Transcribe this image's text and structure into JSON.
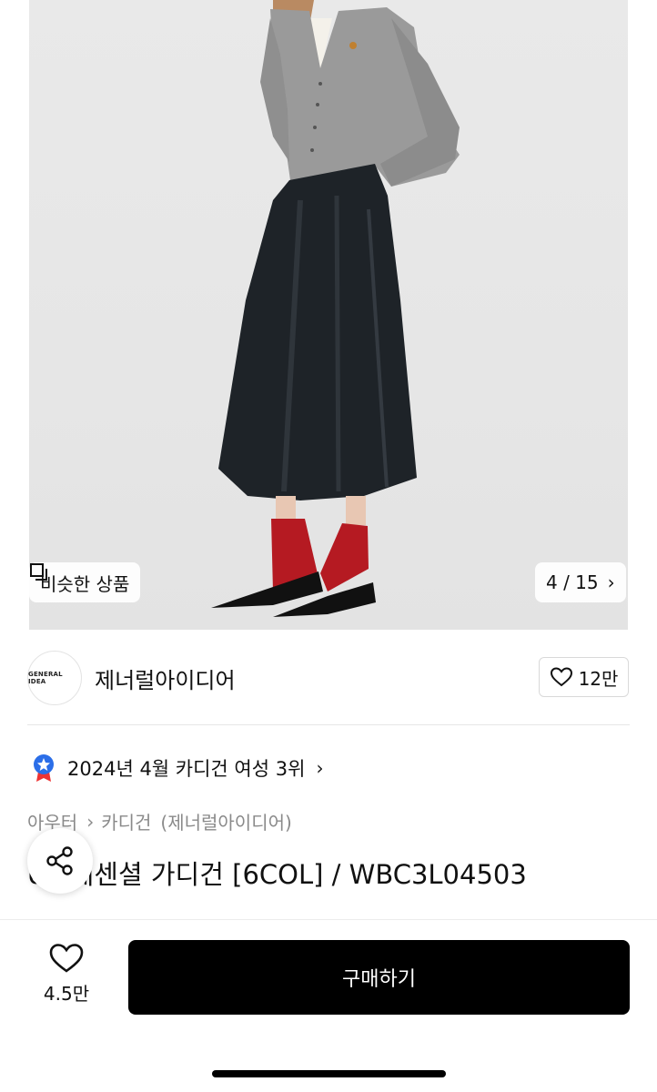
{
  "hero": {
    "similar_label": "비슷한 상품",
    "page_indicator": "4 / 15",
    "icons": [
      "similar-products-icon",
      "chevron-right-icon"
    ]
  },
  "brand": {
    "logo_text": "GENERAL IDEA",
    "name": "제너럴아이디어",
    "likes": "12만"
  },
  "ranking": {
    "text": "2024년 4월 카디건 여성 3위",
    "icon": "star-badge-icon"
  },
  "breadcrumb": {
    "category": "아우터",
    "subcategory": "카디건",
    "brand": "(제너럴아이디어)"
  },
  "product": {
    "title_visible": "L 에센셜 가디건 [6COL] / WBC3L04503",
    "title_fragment": "U"
  },
  "bottom_bar": {
    "wish_count": "4.5만",
    "buy_label": "구매하기"
  },
  "colors": {
    "background": "#ffffff",
    "buy_button": "#000000",
    "muted_text": "#8a8a8a",
    "badge_blue": "#2b6ee8"
  }
}
